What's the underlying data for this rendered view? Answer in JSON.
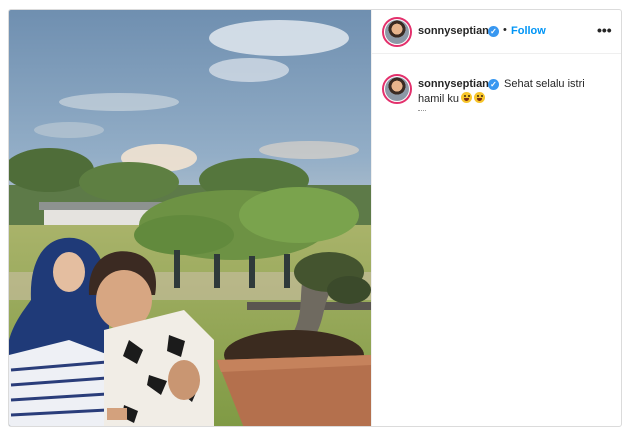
{
  "post": {
    "username": "sonnyseptian",
    "verified_symbol": "✓",
    "separator": "•",
    "follow_label": "Follow",
    "more_label": "•••",
    "caption_part1": "Sehat selalu istri",
    "caption_part2": "hamil ku",
    "caption_emojis": [
      "grinning-face-emoji",
      "zany-face-emoji"
    ]
  },
  "colors": {
    "accent": "#0095f6",
    "verified": "#3897f0",
    "text": "#262626",
    "story_ring": "#e3306c"
  },
  "icons": [
    "verified-badge-icon",
    "more-options-icon"
  ]
}
